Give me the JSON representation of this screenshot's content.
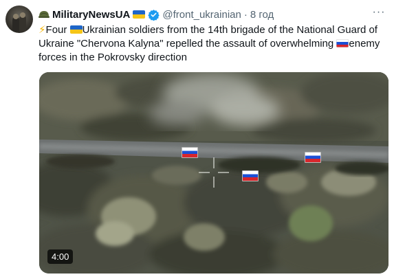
{
  "post": {
    "display_name": "MilitaryNewsUA",
    "handle": "@front_ukrainian",
    "separator": "·",
    "time": "8 год",
    "text_parts": {
      "p1": "Four ",
      "p2": "Ukrainian soldiers from the 14th brigade of the National Guard of Ukraine \"Chervona Kalyna\" repelled the assault of overwhelming ",
      "p3": "enemy forces in the Pokrovsky direction"
    },
    "more_label": "···"
  },
  "media": {
    "type": "video",
    "duration": "4:00",
    "markers": [
      "russia-flag",
      "russia-flag",
      "russia-flag"
    ]
  },
  "icons": {
    "helmet": "helmet-icon",
    "verified": "verified-badge-icon",
    "bolt": "lightning-icon",
    "ua_flag": "ukraine-flag-icon",
    "ru_flag": "russia-flag-icon"
  },
  "colors": {
    "text": "#0f1419",
    "muted": "#536471",
    "verified": "#1d9bf0",
    "ua_blue": "#1f66c8",
    "ua_yellow": "#f5c518"
  }
}
